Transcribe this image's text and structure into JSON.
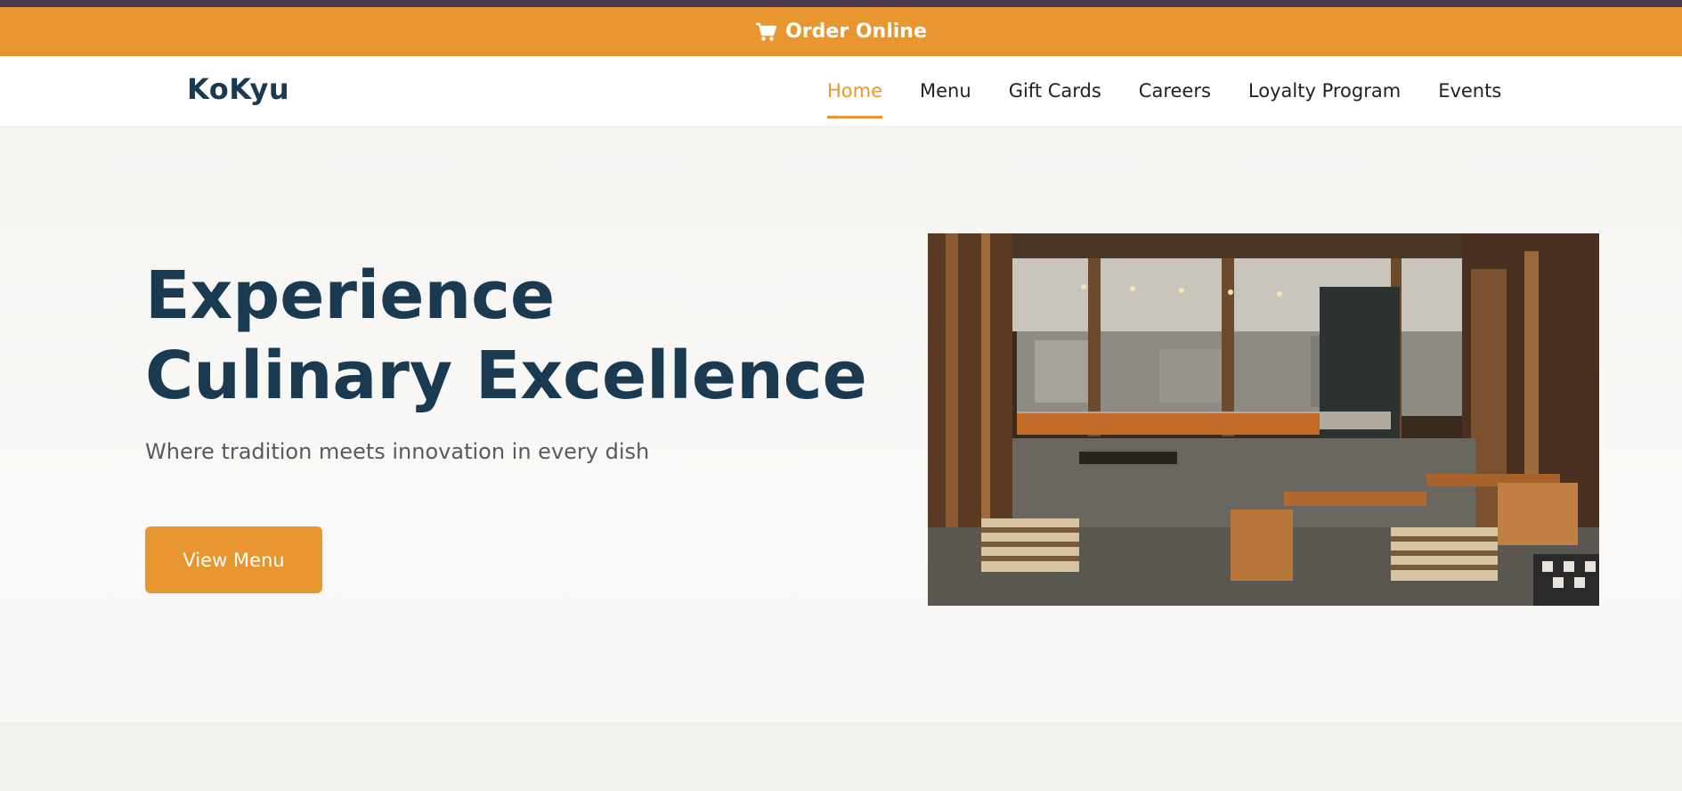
{
  "order_bar": {
    "label": "Order Online",
    "icon": "cart-icon"
  },
  "nav": {
    "logo": "KoKyu",
    "items": [
      {
        "label": "Home",
        "active": true
      },
      {
        "label": "Menu",
        "active": false
      },
      {
        "label": "Gift Cards",
        "active": false
      },
      {
        "label": "Careers",
        "active": false
      },
      {
        "label": "Loyalty Program",
        "active": false
      },
      {
        "label": "Events",
        "active": false
      }
    ]
  },
  "hero": {
    "title": "Experience Culinary Excellence",
    "subtitle": "Where tradition meets innovation in every dish",
    "cta_label": "View Menu",
    "image_subject": "restaurant-interior-photo"
  },
  "colors": {
    "accent": "#e8962f",
    "heading": "#1a3a52",
    "top_strip": "#4a3a4c"
  }
}
